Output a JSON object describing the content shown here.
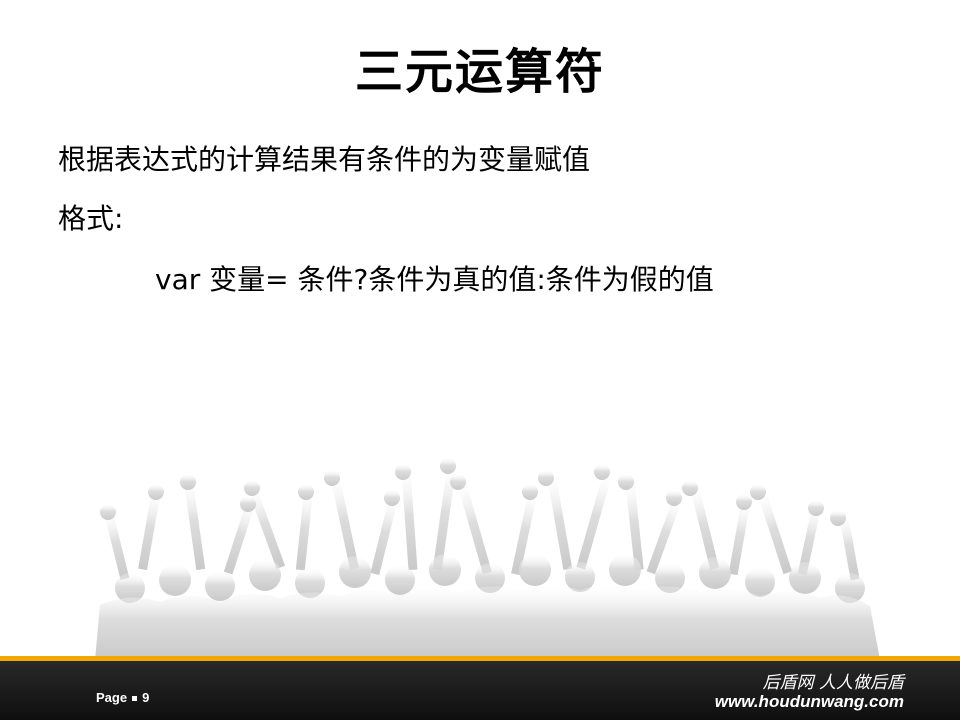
{
  "slide": {
    "title": "三元运算符",
    "lines": [
      "根据表达式的计算结果有条件的为变量赋值",
      "格式:",
      "var  变量=  条件?条件为真的值:条件为假的值"
    ]
  },
  "footer": {
    "page_label": "Page",
    "page_number": "9",
    "slogan": "后盾网 人人做后盾",
    "url": "www.houdunwang.com"
  },
  "colors": {
    "footer_bg": "#1a1a1a",
    "accent": "#f0a800",
    "crowd": "#d6d6d6"
  },
  "icons": {
    "background": "crowd-silhouette-icon"
  }
}
